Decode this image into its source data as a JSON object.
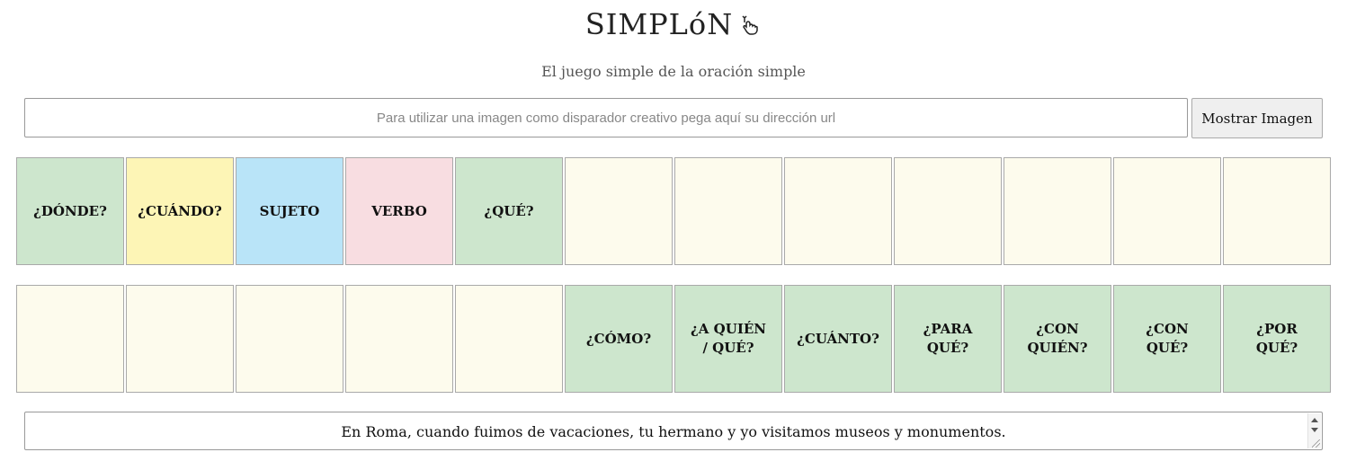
{
  "header": {
    "title": "SIMPLóN",
    "subtitle": "El juego simple de la oración simple"
  },
  "image_url": {
    "placeholder": "Para utilizar una imagen como disparador creativo pega aquí su dirección url",
    "value": "",
    "button_label": "Mostrar Imagen"
  },
  "colors": {
    "green": "#cde6cd",
    "yellow": "#fdf5b6",
    "blue": "#b9e4f8",
    "pink": "#f8dde1",
    "empty": "#fdfbed"
  },
  "rows": [
    {
      "cells": [
        {
          "label": "¿DÓNDE?",
          "color": "green"
        },
        {
          "label": "¿CUÁNDO?",
          "color": "yellow"
        },
        {
          "label": "SUJETO",
          "color": "blue"
        },
        {
          "label": "VERBO",
          "color": "pink"
        },
        {
          "label": "¿QUÉ?",
          "color": "green"
        },
        {
          "label": "",
          "color": "empty"
        },
        {
          "label": "",
          "color": "empty"
        },
        {
          "label": "",
          "color": "empty"
        },
        {
          "label": "",
          "color": "empty"
        },
        {
          "label": "",
          "color": "empty"
        },
        {
          "label": "",
          "color": "empty"
        },
        {
          "label": "",
          "color": "empty"
        }
      ]
    },
    {
      "cells": [
        {
          "label": "",
          "color": "empty"
        },
        {
          "label": "",
          "color": "empty"
        },
        {
          "label": "",
          "color": "empty"
        },
        {
          "label": "",
          "color": "empty"
        },
        {
          "label": "",
          "color": "empty"
        },
        {
          "label": "¿CÓMO?",
          "color": "green"
        },
        {
          "label": "¿A QUIÉN / QUÉ?",
          "color": "green"
        },
        {
          "label": "¿CUÁNTO?",
          "color": "green"
        },
        {
          "label": "¿PARA QUÉ?",
          "color": "green"
        },
        {
          "label": "¿CON QUIÉN?",
          "color": "green"
        },
        {
          "label": "¿CON QUÉ?",
          "color": "green"
        },
        {
          "label": "¿POR QUÉ?",
          "color": "green"
        }
      ]
    }
  ],
  "sentence": "En Roma, cuando fuimos de vacaciones, tu hermano y yo visitamos museos y monumentos."
}
